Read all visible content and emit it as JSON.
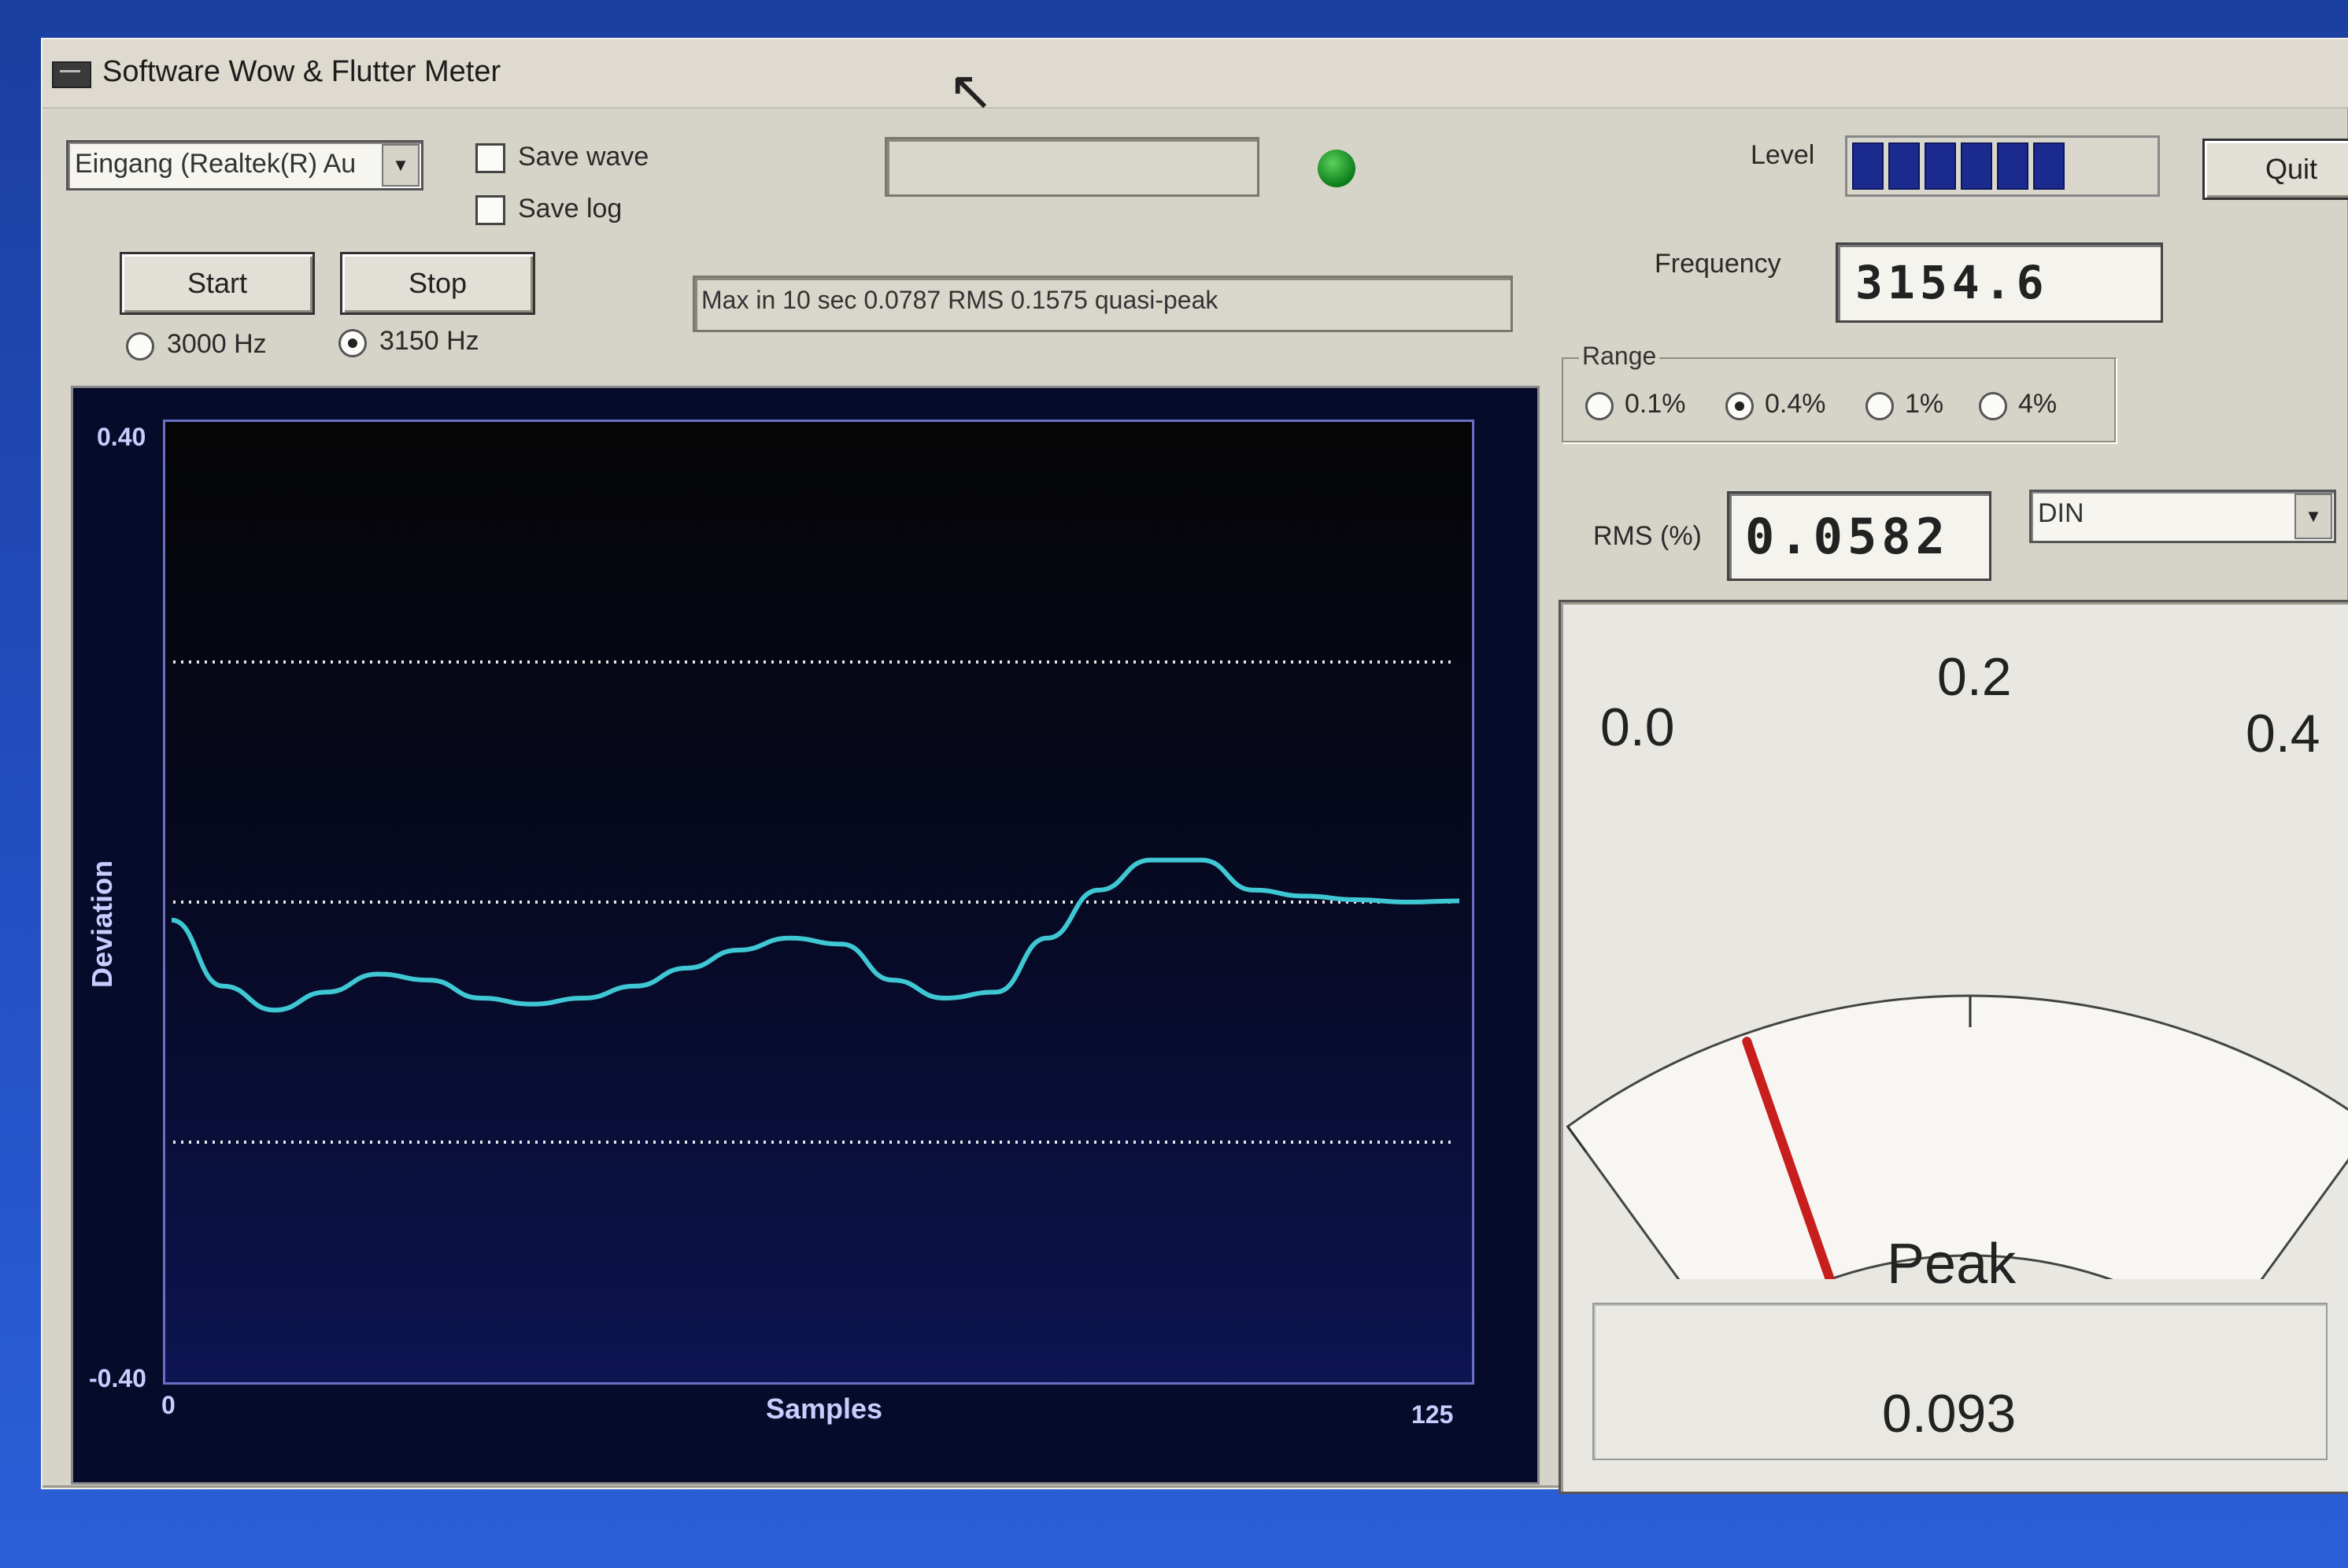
{
  "window": {
    "title": "Software Wow & Flutter Meter"
  },
  "toolbar": {
    "input_device": "Eingang (Realtek(R) Au",
    "save_wave_label": "Save wave",
    "save_log_label": "Save log",
    "level_label": "Level",
    "level_segments_lit": 6,
    "quit_label": "Quit",
    "start_label": "Start",
    "stop_label": "Stop",
    "freq_option_1": "3000 Hz",
    "freq_option_2": "3150 Hz",
    "selected_freq": "3150 Hz",
    "status_text": "Max in 10 sec 0.0787 RMS 0.1575 quasi-peak"
  },
  "readouts": {
    "frequency_label": "Frequency",
    "frequency_value": "3154.6",
    "rms_label": "RMS (%)",
    "rms_value": "0.0582",
    "weighting": "DIN"
  },
  "range": {
    "legend": "Range",
    "options": [
      "0.1%",
      "0.4%",
      "1%",
      "4%"
    ],
    "selected": "0.4%"
  },
  "chart_data": {
    "type": "line",
    "xlabel": "Samples",
    "ylabel": "Deviation",
    "xlim": [
      0,
      125
    ],
    "ylim": [
      -0.4,
      0.4
    ],
    "y_tick_labels": [
      "0.40",
      "-0.40"
    ],
    "x_tick_labels": [
      "0",
      "125"
    ],
    "grid": "dotted horizontal at -0.2, 0, 0.2",
    "series": [
      {
        "color": "#3fc7d4",
        "x": [
          0,
          5,
          10,
          15,
          20,
          25,
          30,
          35,
          40,
          45,
          50,
          55,
          60,
          65,
          70,
          75,
          80,
          85,
          90,
          95,
          100,
          105,
          110,
          115,
          120,
          125
        ],
        "y": [
          -0.015,
          -0.07,
          -0.09,
          -0.075,
          -0.06,
          -0.065,
          -0.08,
          -0.085,
          -0.08,
          -0.07,
          -0.055,
          -0.04,
          -0.03,
          -0.035,
          -0.065,
          -0.08,
          -0.075,
          -0.03,
          0.01,
          0.035,
          0.035,
          0.01,
          0.005,
          0.002,
          0.0,
          0.001
        ]
      }
    ]
  },
  "gauge": {
    "scale_labels": [
      "0.0",
      "0.2",
      "0.4"
    ],
    "peak_label": "Peak",
    "peak_value": "0.093",
    "needle_value": 0.093,
    "scale_max": 0.4
  },
  "colors": {
    "trace": "#3fc7d4",
    "needle": "#c81e1e",
    "level": "#1a2a8e",
    "led": "#1fa32d"
  }
}
